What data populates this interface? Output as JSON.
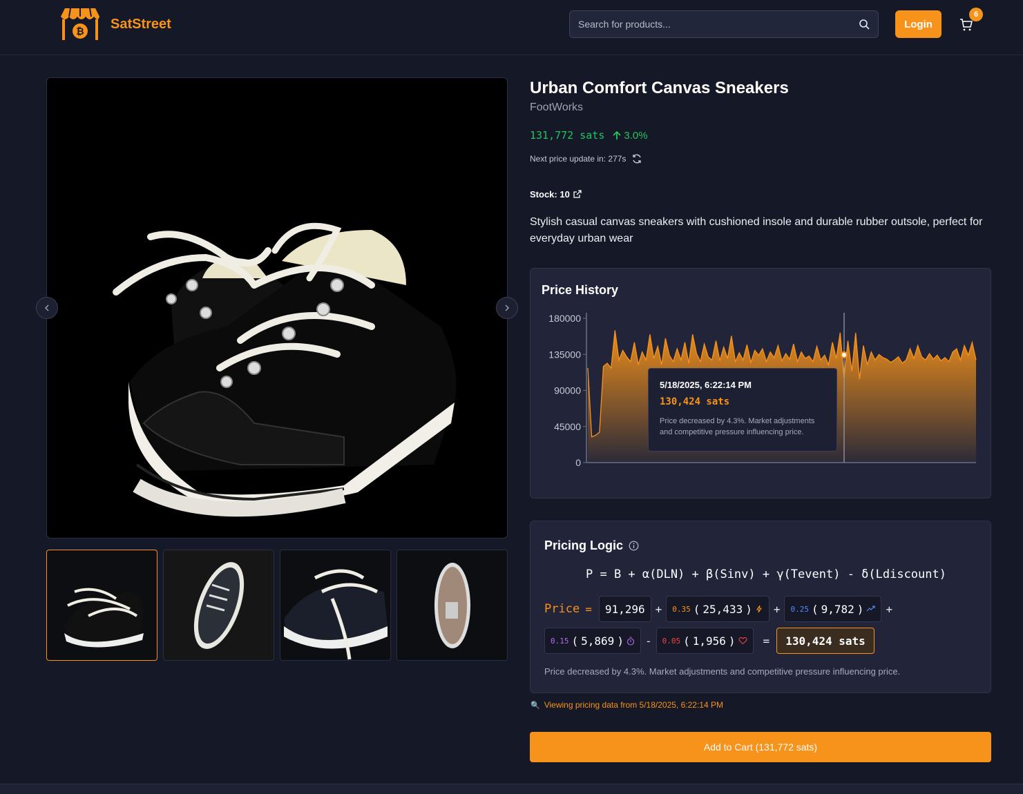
{
  "header": {
    "brand": "SatStreet",
    "search_placeholder": "Search for products...",
    "login_label": "Login",
    "cart_count": "6"
  },
  "product": {
    "title": "Urban Comfort Canvas Sneakers",
    "brand": "FootWorks",
    "price": "131,772 sats",
    "change": "3.0%",
    "next_update": "Next price update in: 277s",
    "stock": "Stock: 10",
    "description": "Stylish casual canvas sneakers with cushioned insole and durable rubber outsole, perfect for everyday urban wear"
  },
  "icons": {
    "cart": "cart-icon",
    "search": "search-icon",
    "refresh": "refresh-icon",
    "external": "external-link-icon",
    "info": "info-icon",
    "bolt": "bolt-icon",
    "trend": "trend-icon",
    "timer": "timer-icon",
    "heart": "heart-icon",
    "magnifier": "magnifier-emoji"
  },
  "colors": {
    "accent": "#f7931a",
    "positive": "#22c55e",
    "background": "#151826",
    "card": "#222539"
  },
  "price_history": {
    "title": "Price History",
    "y_ticks": [
      "180000",
      "135000",
      "90000",
      "45000",
      "0"
    ],
    "tooltip": {
      "date": "5/18/2025, 6:22:14 PM",
      "price": "130,424 sats",
      "message": "Price decreased by 4.3%. Market adjustments and competitive pressure influencing price."
    }
  },
  "chart_data": {
    "type": "area",
    "title": "Price History",
    "ylim": [
      0,
      180000
    ],
    "yticks": [
      0,
      45000,
      90000,
      135000,
      180000
    ],
    "grid": false,
    "highlight": {
      "date": "5/18/2025, 6:22:14 PM",
      "value": 130424
    },
    "values": [
      118000,
      32000,
      34000,
      38000,
      120000,
      124000,
      118000,
      165000,
      128000,
      140000,
      132000,
      126000,
      150000,
      122000,
      138000,
      128000,
      160000,
      130000,
      145000,
      122000,
      155000,
      134000,
      126000,
      142000,
      128000,
      150000,
      124000,
      160000,
      136000,
      126000,
      148000,
      132000,
      128000,
      152000,
      127000,
      144000,
      130000,
      158000,
      126000,
      137000,
      128000,
      147000,
      125000,
      140000,
      134000,
      142000,
      126000,
      138000,
      131000,
      146000,
      127000,
      136000,
      129000,
      148000,
      126000,
      138000,
      130000,
      133000,
      126000,
      145000,
      128000,
      134000,
      122000,
      150000,
      130000,
      162000,
      106000,
      152000,
      114000,
      162000,
      104000,
      146000,
      122000,
      138000,
      128000,
      135000,
      131000,
      129000,
      125000,
      128000,
      132000,
      124000,
      128000,
      142000,
      130000,
      146000,
      132000,
      128000,
      136000,
      129000,
      134000,
      127000,
      131000,
      126000,
      138000,
      142000,
      128000,
      146000,
      134000,
      150000,
      128000
    ]
  },
  "pricing_logic": {
    "title": "Pricing Logic",
    "formula": "P = B + α(DLN) + β(Sinv) + γ(Tevent) - δ(Ldiscount)",
    "price_label": "Price",
    "eq": "=",
    "base": "91,296",
    "plus": "+",
    "minus": "-",
    "terms": [
      {
        "coef": "0.35",
        "value": "25,433",
        "color": "#f7931a"
      },
      {
        "coef": "0.25",
        "value": "9,782",
        "color": "#4f8cf7"
      },
      {
        "coef": "0.15",
        "value": "5,869",
        "color": "#b06ee8"
      },
      {
        "coef": "0.05",
        "value": "1,956",
        "color": "#ef4444"
      }
    ],
    "result": "130,424 sats",
    "note": "Price decreased by 4.3%. Market adjustments and competitive pressure influencing price."
  },
  "viewing_note": "Viewing pricing data from 5/18/2025, 6:22:14 PM",
  "add_to_cart_label": "Add to Cart (131,772 sats)"
}
